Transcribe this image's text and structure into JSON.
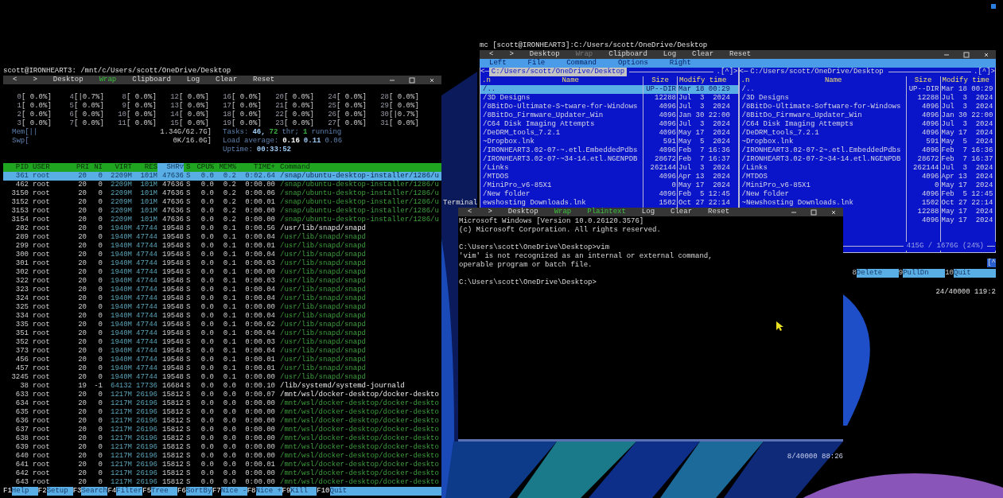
{
  "htop": {
    "title": "scott@IRONHEART3: /mnt/c/Users/scott/OneDrive/Desktop",
    "toolbar": [
      {
        "label": "<",
        "kind": "action"
      },
      {
        "label": ">",
        "kind": "action"
      },
      {
        "label": "Desktop",
        "kind": "action"
      },
      {
        "label": "Wrap",
        "kind": "toggle",
        "on": true
      },
      {
        "label": "Clipboard",
        "kind": "action"
      },
      {
        "label": "Log",
        "kind": "action"
      },
      {
        "label": "Clear",
        "kind": "action"
      },
      {
        "label": "Reset",
        "kind": "action"
      }
    ],
    "cpus": [
      {
        "label": "0",
        "meter": "[ 0.0%]"
      },
      {
        "label": "1",
        "meter": "[ 0.0%]"
      },
      {
        "label": "2",
        "meter": "[ 0.0%]"
      },
      {
        "label": "3",
        "meter": "[ 0.0%]"
      },
      {
        "label": "4",
        "meter": "[|0.7%]"
      },
      {
        "label": "5",
        "meter": "[ 0.0%]"
      },
      {
        "label": "6",
        "meter": "[ 0.0%]"
      },
      {
        "label": "7",
        "meter": "[ 0.0%]"
      },
      {
        "label": "8",
        "meter": "[ 0.0%]"
      },
      {
        "label": "9",
        "meter": "[ 0.0%]"
      },
      {
        "label": "10",
        "meter": "[ 0.0%]"
      },
      {
        "label": "11",
        "meter": "[ 0.0%]"
      },
      {
        "label": "12",
        "meter": "[ 0.0%]"
      },
      {
        "label": "13",
        "meter": "[ 0.0%]"
      },
      {
        "label": "14",
        "meter": "[ 0.0%]"
      },
      {
        "label": "15",
        "meter": "[ 0.0%]"
      },
      {
        "label": "16",
        "meter": "[ 0.0%]"
      },
      {
        "label": "17",
        "meter": "[ 0.0%]"
      },
      {
        "label": "18",
        "meter": "[ 0.0%]"
      },
      {
        "label": "19",
        "meter": "[ 0.0%]"
      },
      {
        "label": "20",
        "meter": "[ 0.0%]"
      },
      {
        "label": "21",
        "meter": "[ 0.0%]"
      },
      {
        "label": "22",
        "meter": "[ 0.0%]"
      },
      {
        "label": "23",
        "meter": "[ 0.0%]"
      },
      {
        "label": "24",
        "meter": "[ 0.0%]"
      },
      {
        "label": "25",
        "meter": "[ 0.0%]"
      },
      {
        "label": "26",
        "meter": "[ 0.0%]"
      },
      {
        "label": "27",
        "meter": "[ 0.0%]"
      },
      {
        "label": "28",
        "meter": "[ 0.0%]"
      },
      {
        "label": "29",
        "meter": "[ 0.0%]"
      },
      {
        "label": "30",
        "meter": "[|0.7%]"
      },
      {
        "label": "31",
        "meter": "[ 0.0%]"
      }
    ],
    "meters": [
      {
        "label": "Mem[||",
        "value": "1.34G/62.7G]"
      },
      {
        "label": "Swp[",
        "value": "0K/16.0G]"
      }
    ],
    "summary": [
      [
        {
          "text": "Tasks:",
          "kind": "label"
        },
        {
          "text": "46,",
          "kind": "value"
        },
        {
          "text": "72",
          "kind": "threads"
        },
        {
          "text": "thr;",
          "kind": "label"
        },
        {
          "text": "1",
          "kind": "threads"
        },
        {
          "text": "running",
          "kind": "label"
        }
      ],
      [
        {
          "text": "Load average:",
          "kind": "label"
        },
        {
          "text": "0.16",
          "kind": "strong"
        },
        {
          "text": "0.11",
          "kind": "value"
        },
        {
          "text": "0.06",
          "kind": "label"
        }
      ],
      [
        {
          "text": "Uptime:",
          "kind": "label"
        },
        {
          "text": "00:33:52",
          "kind": "value"
        }
      ]
    ],
    "columns": [
      {
        "label": "PID",
        "selected": false
      },
      {
        "label": "USER",
        "selected": false
      },
      {
        "label": "PRI",
        "selected": false
      },
      {
        "label": "NI",
        "selected": false
      },
      {
        "label": "VIRT",
        "selected": false
      },
      {
        "label": "RES",
        "selected": false
      },
      {
        "label": "SHR▽",
        "selected": true
      },
      {
        "label": "S",
        "selected": false
      },
      {
        "label": "CPU%",
        "selected": false
      },
      {
        "label": "MEM%",
        "selected": false
      },
      {
        "label": "TIME+",
        "selected": false
      },
      {
        "label": "Command",
        "selected": false
      }
    ],
    "rows": [
      {
        "pid": "361",
        "user": "root",
        "pri": "20",
        "ni": "0",
        "virt": "2209M",
        "res": "101M",
        "shr": "47636",
        "s": "S",
        "cpu": "0.0",
        "mem": "0.2",
        "time": "0:02.64",
        "command": "/snap/ubuntu-desktop-installer/1286/u",
        "kind": "process",
        "selected": true
      },
      {
        "pid": "462",
        "user": "root",
        "pri": "20",
        "ni": "0",
        "virt": "2209M",
        "res": "101M",
        "shr": "47636",
        "s": "S",
        "cpu": "0.0",
        "mem": "0.2",
        "time": "0:00.00",
        "command": "/snap/ubuntu-desktop-installer/1286/u",
        "kind": "thread",
        "selected": false
      },
      {
        "pid": "3150",
        "user": "root",
        "pri": "20",
        "ni": "0",
        "virt": "2209M",
        "res": "101M",
        "shr": "47636",
        "s": "S",
        "cpu": "0.0",
        "mem": "0.2",
        "time": "0:00.06",
        "command": "/snap/ubuntu-desktop-installer/1286/u",
        "kind": "thread",
        "selected": false
      },
      {
        "pid": "3152",
        "user": "root",
        "pri": "20",
        "ni": "0",
        "virt": "2209M",
        "res": "101M",
        "shr": "47636",
        "s": "S",
        "cpu": "0.0",
        "mem": "0.2",
        "time": "0:00.01",
        "command": "/snap/ubuntu-desktop-installer/1286/u",
        "kind": "thread",
        "selected": false
      },
      {
        "pid": "3153",
        "user": "root",
        "pri": "20",
        "ni": "0",
        "virt": "2209M",
        "res": "101M",
        "shr": "47636",
        "s": "S",
        "cpu": "0.0",
        "mem": "0.2",
        "time": "0:00.00",
        "command": "/snap/ubuntu-desktop-installer/1286/u",
        "kind": "thread",
        "selected": false
      },
      {
        "pid": "3154",
        "user": "root",
        "pri": "20",
        "ni": "0",
        "virt": "2209M",
        "res": "101M",
        "shr": "47636",
        "s": "S",
        "cpu": "0.0",
        "mem": "0.2",
        "time": "0:00.00",
        "command": "/snap/ubuntu-desktop-installer/1286/u",
        "kind": "thread",
        "selected": false
      },
      {
        "pid": "202",
        "user": "root",
        "pri": "20",
        "ni": "0",
        "virt": "1940M",
        "res": "47744",
        "shr": "19548",
        "s": "S",
        "cpu": "0.0",
        "mem": "0.1",
        "time": "0:00.56",
        "command": "/usr/lib/snapd/snapd",
        "kind": "process",
        "selected": false
      },
      {
        "pid": "289",
        "user": "root",
        "pri": "20",
        "ni": "0",
        "virt": "1940M",
        "res": "47744",
        "shr": "19548",
        "s": "S",
        "cpu": "0.0",
        "mem": "0.1",
        "time": "0:00.04",
        "command": "/usr/lib/snapd/snapd",
        "kind": "thread",
        "selected": false
      },
      {
        "pid": "299",
        "user": "root",
        "pri": "20",
        "ni": "0",
        "virt": "1940M",
        "res": "47744",
        "shr": "19548",
        "s": "S",
        "cpu": "0.0",
        "mem": "0.1",
        "time": "0:00.01",
        "command": "/usr/lib/snapd/snapd",
        "kind": "thread",
        "selected": false
      },
      {
        "pid": "300",
        "user": "root",
        "pri": "20",
        "ni": "0",
        "virt": "1940M",
        "res": "47744",
        "shr": "19548",
        "s": "S",
        "cpu": "0.0",
        "mem": "0.1",
        "time": "0:00.04",
        "command": "/usr/lib/snapd/snapd",
        "kind": "thread",
        "selected": false
      },
      {
        "pid": "301",
        "user": "root",
        "pri": "20",
        "ni": "0",
        "virt": "1940M",
        "res": "47744",
        "shr": "19548",
        "s": "S",
        "cpu": "0.0",
        "mem": "0.1",
        "time": "0:00.03",
        "command": "/usr/lib/snapd/snapd",
        "kind": "thread",
        "selected": false
      },
      {
        "pid": "302",
        "user": "root",
        "pri": "20",
        "ni": "0",
        "virt": "1940M",
        "res": "47744",
        "shr": "19548",
        "s": "S",
        "cpu": "0.0",
        "mem": "0.1",
        "time": "0:00.00",
        "command": "/usr/lib/snapd/snapd",
        "kind": "thread",
        "selected": false
      },
      {
        "pid": "322",
        "user": "root",
        "pri": "20",
        "ni": "0",
        "virt": "1940M",
        "res": "47744",
        "shr": "19548",
        "s": "S",
        "cpu": "0.0",
        "mem": "0.1",
        "time": "0:00.03",
        "command": "/usr/lib/snapd/snapd",
        "kind": "thread",
        "selected": false
      },
      {
        "pid": "323",
        "user": "root",
        "pri": "20",
        "ni": "0",
        "virt": "1940M",
        "res": "47744",
        "shr": "19548",
        "s": "S",
        "cpu": "0.0",
        "mem": "0.1",
        "time": "0:00.04",
        "command": "/usr/lib/snapd/snapd",
        "kind": "thread",
        "selected": false
      },
      {
        "pid": "324",
        "user": "root",
        "pri": "20",
        "ni": "0",
        "virt": "1940M",
        "res": "47744",
        "shr": "19548",
        "s": "S",
        "cpu": "0.0",
        "mem": "0.1",
        "time": "0:00.04",
        "command": "/usr/lib/snapd/snapd",
        "kind": "thread",
        "selected": false
      },
      {
        "pid": "325",
        "user": "root",
        "pri": "20",
        "ni": "0",
        "virt": "1940M",
        "res": "47744",
        "shr": "19548",
        "s": "S",
        "cpu": "0.0",
        "mem": "0.1",
        "time": "0:00.00",
        "command": "/usr/lib/snapd/snapd",
        "kind": "thread",
        "selected": false
      },
      {
        "pid": "334",
        "user": "root",
        "pri": "20",
        "ni": "0",
        "virt": "1940M",
        "res": "47744",
        "shr": "19548",
        "s": "S",
        "cpu": "0.0",
        "mem": "0.1",
        "time": "0:00.04",
        "command": "/usr/lib/snapd/snapd",
        "kind": "thread",
        "selected": false
      },
      {
        "pid": "335",
        "user": "root",
        "pri": "20",
        "ni": "0",
        "virt": "1940M",
        "res": "47744",
        "shr": "19548",
        "s": "S",
        "cpu": "0.0",
        "mem": "0.1",
        "time": "0:00.02",
        "command": "/usr/lib/snapd/snapd",
        "kind": "thread",
        "selected": false
      },
      {
        "pid": "351",
        "user": "root",
        "pri": "20",
        "ni": "0",
        "virt": "1940M",
        "res": "47744",
        "shr": "19548",
        "s": "S",
        "cpu": "0.0",
        "mem": "0.1",
        "time": "0:00.04",
        "command": "/usr/lib/snapd/snapd",
        "kind": "thread",
        "selected": false
      },
      {
        "pid": "352",
        "user": "root",
        "pri": "20",
        "ni": "0",
        "virt": "1940M",
        "res": "47744",
        "shr": "19548",
        "s": "S",
        "cpu": "0.0",
        "mem": "0.1",
        "time": "0:00.03",
        "command": "/usr/lib/snapd/snapd",
        "kind": "thread",
        "selected": false
      },
      {
        "pid": "373",
        "user": "root",
        "pri": "20",
        "ni": "0",
        "virt": "1940M",
        "res": "47744",
        "shr": "19548",
        "s": "S",
        "cpu": "0.0",
        "mem": "0.1",
        "time": "0:00.04",
        "command": "/usr/lib/snapd/snapd",
        "kind": "thread",
        "selected": false
      },
      {
        "pid": "456",
        "user": "root",
        "pri": "20",
        "ni": "0",
        "virt": "1940M",
        "res": "47744",
        "shr": "19548",
        "s": "S",
        "cpu": "0.0",
        "mem": "0.1",
        "time": "0:00.01",
        "command": "/usr/lib/snapd/snapd",
        "kind": "thread",
        "selected": false
      },
      {
        "pid": "457",
        "user": "root",
        "pri": "20",
        "ni": "0",
        "virt": "1940M",
        "res": "47744",
        "shr": "19548",
        "s": "S",
        "cpu": "0.0",
        "mem": "0.1",
        "time": "0:00.01",
        "command": "/usr/lib/snapd/snapd",
        "kind": "thread",
        "selected": false
      },
      {
        "pid": "3245",
        "user": "root",
        "pri": "20",
        "ni": "0",
        "virt": "1940M",
        "res": "47744",
        "shr": "19548",
        "s": "S",
        "cpu": "0.0",
        "mem": "0.1",
        "time": "0:00.00",
        "command": "/usr/lib/snapd/snapd",
        "kind": "thread",
        "selected": false
      },
      {
        "pid": "38",
        "user": "root",
        "pri": "19",
        "ni": "-1",
        "virt": "64132",
        "res": "17736",
        "shr": "16684",
        "s": "S",
        "cpu": "0.0",
        "mem": "0.0",
        "time": "0:00.10",
        "command": "/lib/systemd/systemd-journald",
        "kind": "process",
        "selected": false
      },
      {
        "pid": "633",
        "user": "root",
        "pri": "20",
        "ni": "0",
        "virt": "1217M",
        "res": "26196",
        "shr": "15812",
        "s": "S",
        "cpu": "0.0",
        "mem": "0.0",
        "time": "0:00.07",
        "command": "/mnt/wsl/docker-desktop/docker-deskto",
        "kind": "process",
        "selected": false
      },
      {
        "pid": "634",
        "user": "root",
        "pri": "20",
        "ni": "0",
        "virt": "1217M",
        "res": "26196",
        "shr": "15812",
        "s": "S",
        "cpu": "0.0",
        "mem": "0.0",
        "time": "0:00.00",
        "command": "/mnt/wsl/docker-desktop/docker-deskto",
        "kind": "thread",
        "selected": false
      },
      {
        "pid": "635",
        "user": "root",
        "pri": "20",
        "ni": "0",
        "virt": "1217M",
        "res": "26196",
        "shr": "15812",
        "s": "S",
        "cpu": "0.0",
        "mem": "0.0",
        "time": "0:00.00",
        "command": "/mnt/wsl/docker-desktop/docker-deskto",
        "kind": "thread",
        "selected": false
      },
      {
        "pid": "636",
        "user": "root",
        "pri": "20",
        "ni": "0",
        "virt": "1217M",
        "res": "26196",
        "shr": "15812",
        "s": "S",
        "cpu": "0.0",
        "mem": "0.0",
        "time": "0:00.00",
        "command": "/mnt/wsl/docker-desktop/docker-deskto",
        "kind": "thread",
        "selected": false
      },
      {
        "pid": "637",
        "user": "root",
        "pri": "20",
        "ni": "0",
        "virt": "1217M",
        "res": "26196",
        "shr": "15812",
        "s": "S",
        "cpu": "0.0",
        "mem": "0.0",
        "time": "0:00.00",
        "command": "/mnt/wsl/docker-desktop/docker-deskto",
        "kind": "thread",
        "selected": false
      },
      {
        "pid": "638",
        "user": "root",
        "pri": "20",
        "ni": "0",
        "virt": "1217M",
        "res": "26196",
        "shr": "15812",
        "s": "S",
        "cpu": "0.0",
        "mem": "0.0",
        "time": "0:00.00",
        "command": "/mnt/wsl/docker-desktop/docker-deskto",
        "kind": "thread",
        "selected": false
      },
      {
        "pid": "639",
        "user": "root",
        "pri": "20",
        "ni": "0",
        "virt": "1217M",
        "res": "26196",
        "shr": "15812",
        "s": "S",
        "cpu": "0.0",
        "mem": "0.0",
        "time": "0:00.00",
        "command": "/mnt/wsl/docker-desktop/docker-deskto",
        "kind": "thread",
        "selected": false
      },
      {
        "pid": "640",
        "user": "root",
        "pri": "20",
        "ni": "0",
        "virt": "1217M",
        "res": "26196",
        "shr": "15812",
        "s": "S",
        "cpu": "0.0",
        "mem": "0.0",
        "time": "0:00.00",
        "command": "/mnt/wsl/docker-desktop/docker-deskto",
        "kind": "thread",
        "selected": false
      },
      {
        "pid": "641",
        "user": "root",
        "pri": "20",
        "ni": "0",
        "virt": "1217M",
        "res": "26196",
        "shr": "15812",
        "s": "S",
        "cpu": "0.0",
        "mem": "0.0",
        "time": "0:00.01",
        "command": "/mnt/wsl/docker-desktop/docker-deskto",
        "kind": "thread",
        "selected": false
      },
      {
        "pid": "642",
        "user": "root",
        "pri": "20",
        "ni": "0",
        "virt": "1217M",
        "res": "26196",
        "shr": "15812",
        "s": "S",
        "cpu": "0.0",
        "mem": "0.0",
        "time": "0:00.00",
        "command": "/mnt/wsl/docker-desktop/docker-deskto",
        "kind": "thread",
        "selected": false
      },
      {
        "pid": "643",
        "user": "root",
        "pri": "20",
        "ni": "0",
        "virt": "1217M",
        "res": "26196",
        "shr": "15812",
        "s": "S",
        "cpu": "0.0",
        "mem": "0.0",
        "time": "0:00.00",
        "command": "/mnt/wsl/docker-desktop/docker-deskto",
        "kind": "thread",
        "selected": false
      }
    ],
    "function_keys": [
      {
        "key": "F1",
        "label": "Help"
      },
      {
        "key": "F2",
        "label": "Setup"
      },
      {
        "key": "F3",
        "label": "Search"
      },
      {
        "key": "F4",
        "label": "Filter"
      },
      {
        "key": "F5",
        "label": "Tree"
      },
      {
        "key": "F6",
        "label": "SortBy"
      },
      {
        "key": "F7",
        "label": "Nice -"
      },
      {
        "key": "F8",
        "label": "Nice +"
      },
      {
        "key": "F9",
        "label": "Kill"
      },
      {
        "key": "F10",
        "label": "Quit"
      }
    ]
  },
  "mc": {
    "title": "mc [scott@IRONHEART3]:C:/Users/scott/OneDrive/Desktop",
    "toolbar": [
      {
        "label": "<",
        "kind": "action"
      },
      {
        "label": ">",
        "kind": "action"
      },
      {
        "label": "Desktop",
        "kind": "action"
      },
      {
        "label": "Wrap",
        "kind": "toggle",
        "on": false
      },
      {
        "label": "Clipboard",
        "kind": "action"
      },
      {
        "label": "Log",
        "kind": "action"
      },
      {
        "label": "Clear",
        "kind": "action"
      },
      {
        "label": "Reset",
        "kind": "action"
      }
    ],
    "menu": [
      "Left",
      "File",
      "Command",
      "Options",
      "Right"
    ],
    "panels": [
      {
        "nav": "<─",
        "path": "C:/Users/scott/OneDrive/Desktop",
        "marker": ".[^]>",
        "selected": true,
        "columns": [
          ".n",
          "Name",
          "Size",
          "Modify time"
        ],
        "rows": [
          {
            "name": "/..",
            "size": "UP--DIR",
            "time": "Mar 18 00:29",
            "selected": true
          },
          {
            "name": "/3D Designs",
            "size": "12288",
            "time": "Jul  3  2024",
            "selected": false
          },
          {
            "name": "/8BitDo-Ultimate-S~tware-for-Windows",
            "size": "4096",
            "time": "Jul  3  2024",
            "selected": false
          },
          {
            "name": "/8BitDo_Firmware_Updater_Win",
            "size": "4096",
            "time": "Jan 30 22:00",
            "selected": false
          },
          {
            "name": "/C64 Disk Imaging Attempts",
            "size": "4096",
            "time": "Jul  3  2024",
            "selected": false
          },
          {
            "name": "/DeDRM_tools_7.2.1",
            "size": "4096",
            "time": "May 17  2024",
            "selected": false
          },
          {
            "name": "~Dropbox.lnk",
            "size": "591",
            "time": "May  5  2024",
            "selected": false
          },
          {
            "name": "/IRONHEART3.02-07-~.etl.EmbeddedPdbs",
            "size": "4096",
            "time": "Feb  7 16:36",
            "selected": false
          },
          {
            "name": "/IRONHEART3.02-07-~34-14.etl.NGENPDB",
            "size": "28672",
            "time": "Feb  7 16:37",
            "selected": false
          },
          {
            "name": "/Links",
            "size": "262144",
            "time": "Jul  3  2024",
            "selected": false
          },
          {
            "name": "/MTDOS",
            "size": "4096",
            "time": "Apr 13  2024",
            "selected": false
          },
          {
            "name": "/MiniPro_v6-85X1",
            "size": "0",
            "time": "May 17  2024",
            "selected": false
          },
          {
            "name": "/New folder",
            "size": "4096",
            "time": "Feb  5 12:45",
            "selected": false
          },
          {
            "name": "ewshosting Downloads.lnk",
            "size": "1502",
            "time": "Oct 27 22:14",
            "selected": false
          }
        ]
      },
      {
        "nav": "<─",
        "path": "C:/Users/scott/OneDrive/Desktop",
        "marker": ".[^]>",
        "selected": false,
        "columns": [
          ".n",
          "Name",
          "Size",
          "Modify time"
        ],
        "rows": [
          {
            "name": "/..",
            "size": "UP--DIR",
            "time": "Mar 18 00:29",
            "selected": false
          },
          {
            "name": "/3D Designs",
            "size": "12288",
            "time": "Jul  3  2024",
            "selected": false
          },
          {
            "name": "/8BitDo-Ultimate-Software-for-Windows",
            "size": "4096",
            "time": "Jul  3  2024",
            "selected": false
          },
          {
            "name": "/8BitDo_Firmware_Updater_Win",
            "size": "4096",
            "time": "Jan 30 22:00",
            "selected": false
          },
          {
            "name": "/C64 Disk Imaging Attempts",
            "size": "4096",
            "time": "Jul  3  2024",
            "selected": false
          },
          {
            "name": "/DeDRM_tools_7.2.1",
            "size": "4096",
            "time": "May 17  2024",
            "selected": false
          },
          {
            "name": "~Dropbox.lnk",
            "size": "591",
            "time": "May  5  2024",
            "selected": false
          },
          {
            "name": "/IRONHEART3.02-07-2~.etl.EmbeddedPdbs",
            "size": "4096",
            "time": "Feb  7 16:36",
            "selected": false
          },
          {
            "name": "/IRONHEART3.02-07-2~34-14.etl.NGENPDB",
            "size": "28672",
            "time": "Feb  7 16:37",
            "selected": false
          },
          {
            "name": "/Links",
            "size": "262144",
            "time": "Jul  3  2024",
            "selected": false
          },
          {
            "name": "/MTDOS",
            "size": "4096",
            "time": "Apr 13  2024",
            "selected": false
          },
          {
            "name": "/MiniPro_v6-85X1",
            "size": "0",
            "time": "May 17  2024",
            "selected": false
          },
          {
            "name": "/New folder",
            "size": "4096",
            "time": "Feb  5 12:45",
            "selected": false
          },
          {
            "name": "~Newshosting Downloads.lnk",
            "size": "1502",
            "time": "Oct 27 22:14",
            "selected": false
          },
          {
            "size": "12288",
            "time": "May 17  2024",
            "selected": false
          },
          {
            "size": "4096",
            "time": "May 17  2024",
            "selected": false
          }
        ]
      }
    ],
    "disk": "415G / 1676G (24%)",
    "hint": "[^",
    "function_keys": [
      {
        "key": "8",
        "label": "Delete"
      },
      {
        "key": "9",
        "label": "PullDn"
      },
      {
        "key": "10",
        "label": "Quit"
      }
    ],
    "status": "24/40000 119:2"
  },
  "cmd": {
    "title": "Terminal",
    "toolbar": [
      {
        "label": "<",
        "kind": "action"
      },
      {
        "label": ">",
        "kind": "action"
      },
      {
        "label": "Desktop",
        "kind": "action"
      },
      {
        "label": "Wrap",
        "kind": "toggle",
        "on": true
      },
      {
        "label": "Plaintext",
        "kind": "toggle",
        "on": true
      },
      {
        "label": "Log",
        "kind": "action"
      },
      {
        "label": "Clear",
        "kind": "action"
      },
      {
        "label": "Reset",
        "kind": "action"
      }
    ],
    "paragraphs": [
      [
        "Microsoft Windows [Version 10.0.26120.3576]",
        "(c) Microsoft Corporation. All rights reserved."
      ],
      [
        "C:\\Users\\scott\\OneDrive\\Desktop>vim",
        "'vim' is not recognized as an internal or external command,",
        "operable program or batch file."
      ],
      [
        "C:\\Users\\scott\\OneDrive\\Desktop>"
      ]
    ],
    "status": "8/40000 88:26"
  }
}
